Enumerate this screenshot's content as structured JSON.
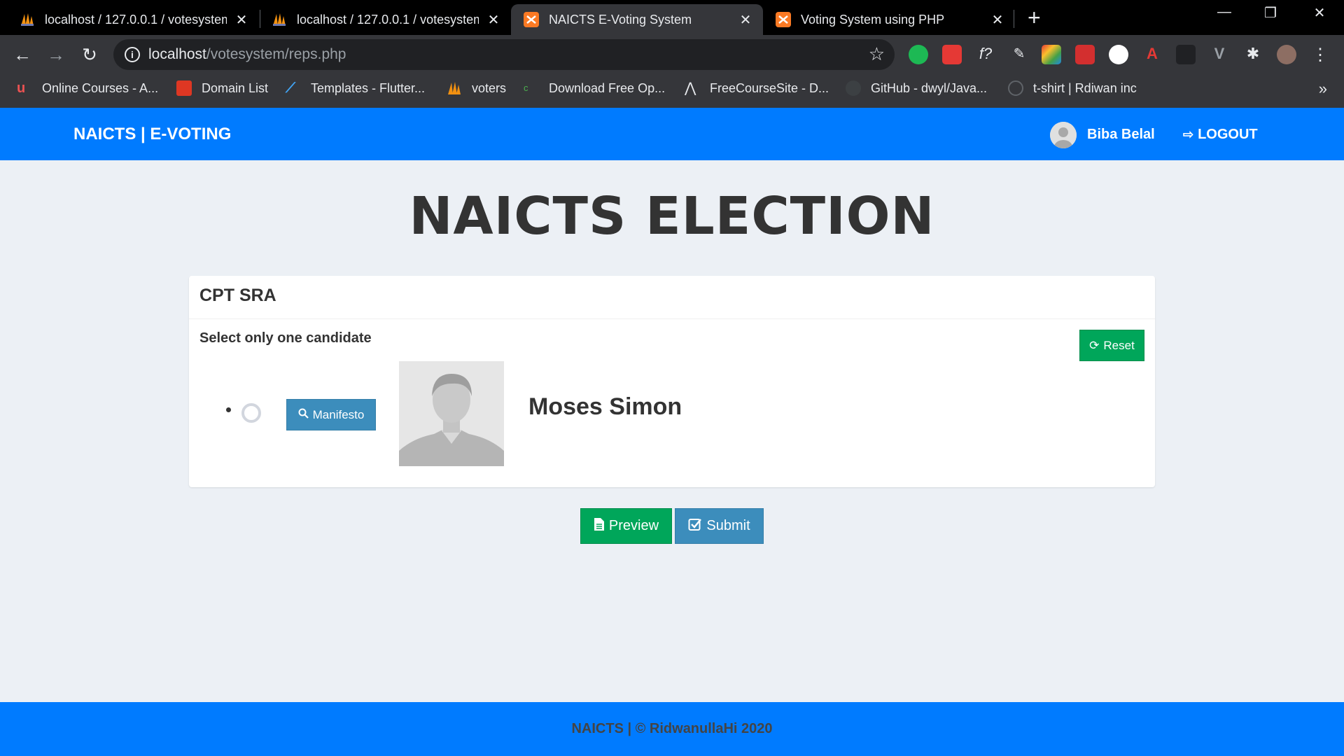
{
  "browser": {
    "tabs": [
      {
        "title": "localhost / 127.0.0.1 / votesystem",
        "icon": "phpmyadmin-icon",
        "active": false
      },
      {
        "title": "localhost / 127.0.0.1 / votesystem",
        "icon": "phpmyadmin-icon",
        "active": false
      },
      {
        "title": "NAICTS E-Voting System",
        "icon": "xampp-icon",
        "active": true
      },
      {
        "title": "Voting System using PHP",
        "icon": "xampp-icon",
        "active": false
      }
    ],
    "url_host": "localhost",
    "url_path": "/votesystem/reps.php",
    "bookmarks": [
      {
        "label": "Online Courses - A...",
        "icon": "udemy-icon"
      },
      {
        "label": "Domain List",
        "icon": "namecheap-icon"
      },
      {
        "label": "Templates - Flutter...",
        "icon": "flutter-icon"
      },
      {
        "label": "voters",
        "icon": "phpmyadmin-icon"
      },
      {
        "label": "Download Free Op...",
        "icon": "coursera-icon"
      },
      {
        "label": "FreeCourseSite - D...",
        "icon": "freecoursesite-icon"
      },
      {
        "label": "GitHub - dwyl/Java...",
        "icon": "github-icon"
      },
      {
        "label": "t-shirt | Rdiwan inc",
        "icon": "wordpress-icon"
      }
    ]
  },
  "nav": {
    "brand": "NAICTS | E-VOTING",
    "user_name": "Biba Belal",
    "logout_label": "LOGOUT"
  },
  "page": {
    "heading": "NAICTS ELECTION"
  },
  "position": {
    "title": "CPT SRA",
    "instruction": "Select only one candidate",
    "reset_label": "Reset",
    "candidates": [
      {
        "name": "Moses Simon",
        "manifesto_label": "Manifesto",
        "selected": false
      }
    ]
  },
  "actions": {
    "preview_label": "Preview",
    "submit_label": "Submit"
  },
  "footer": {
    "text": "NAICTS | © RidwanullaHi 2020"
  },
  "colors": {
    "navbar": "#007bff",
    "success": "#00a65a",
    "primary": "#3c8dbc",
    "background": "#ecf0f5"
  }
}
